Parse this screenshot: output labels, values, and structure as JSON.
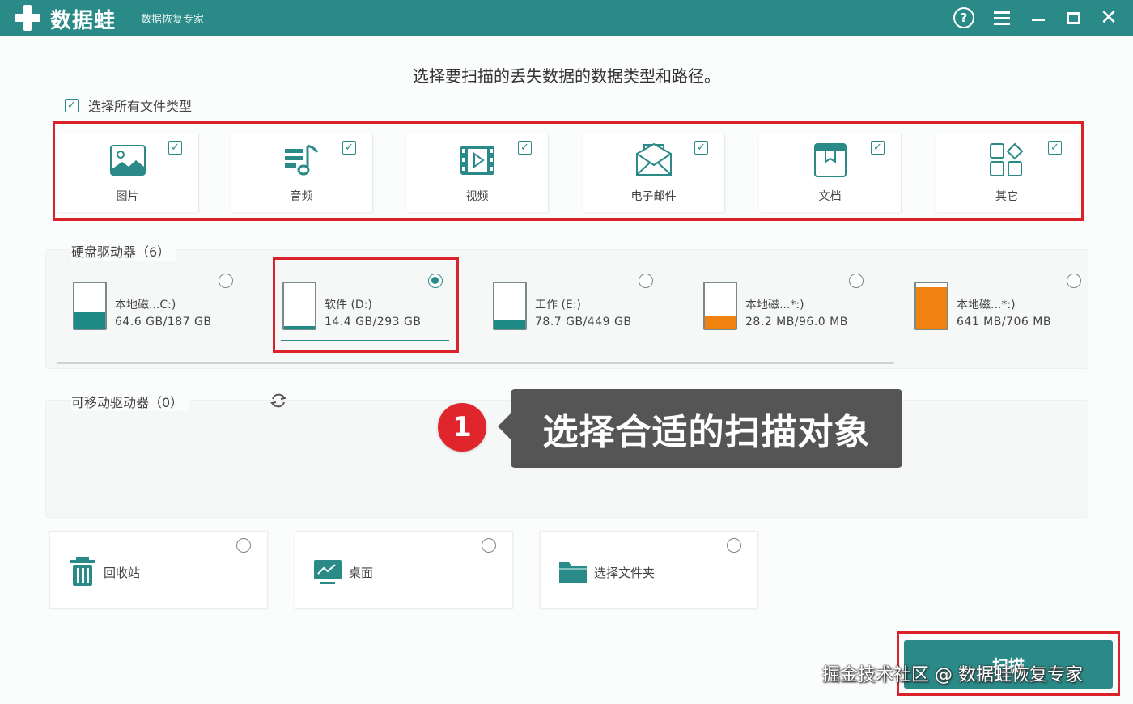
{
  "titlebar": {
    "app_name": "数据蛙",
    "app_subtitle": "数据恢复专家",
    "help_glyph": "?",
    "close_glyph": "✕"
  },
  "main": {
    "heading": "选择要扫描的丢失数据的数据类型和路径。",
    "select_all": {
      "label": "选择所有文件类型",
      "checked": true
    },
    "file_types": [
      {
        "label": "图片",
        "icon": "image-icon",
        "checked": true
      },
      {
        "label": "音频",
        "icon": "music-icon",
        "checked": true
      },
      {
        "label": "视频",
        "icon": "video-icon",
        "checked": true
      },
      {
        "label": "电子邮件",
        "icon": "email-icon",
        "checked": true
      },
      {
        "label": "文档",
        "icon": "document-icon",
        "checked": true
      },
      {
        "label": "其它",
        "icon": "other-icon",
        "checked": true
      }
    ],
    "hard_drives": {
      "label": "硬盘驱动器（6）",
      "items": [
        {
          "name": "本地磁...C:)",
          "size": "64.6 GB/187 GB",
          "used_fraction": 0.35,
          "color": "#1e8a86",
          "selected": false
        },
        {
          "name": "软件 (D:)",
          "size": "14.4 GB/293 GB",
          "used_fraction": 0.05,
          "color": "#1e8a86",
          "selected": true
        },
        {
          "name": "工作 (E:)",
          "size": "78.7 GB/449 GB",
          "used_fraction": 0.18,
          "color": "#1e8a86",
          "selected": false
        },
        {
          "name": "本地磁...*:)",
          "size": "28.2 MB/96.0 MB",
          "used_fraction": 0.29,
          "color": "#f0820f",
          "selected": false
        },
        {
          "name": "本地磁...*:)",
          "size": "641 MB/706 MB",
          "used_fraction": 0.91,
          "color": "#f0820f",
          "selected": false
        }
      ]
    },
    "removable_drives": {
      "label": "可移动驱动器（0）"
    },
    "locations": [
      {
        "label": "回收站",
        "icon": "recycle-bin-icon",
        "selected": false
      },
      {
        "label": "桌面",
        "icon": "desktop-icon",
        "selected": false
      },
      {
        "label": "选择文件夹",
        "icon": "folder-icon",
        "selected": false
      }
    ],
    "callout": {
      "number": "1",
      "text": "选择合适的扫描对象"
    },
    "scan_button": "扫描",
    "watermark": "掘金技术社区 @ 数据蛙恢复专家"
  },
  "colors": {
    "brand": "#2a8a87",
    "highlight": "#d9222a",
    "warning": "#f0820f"
  }
}
